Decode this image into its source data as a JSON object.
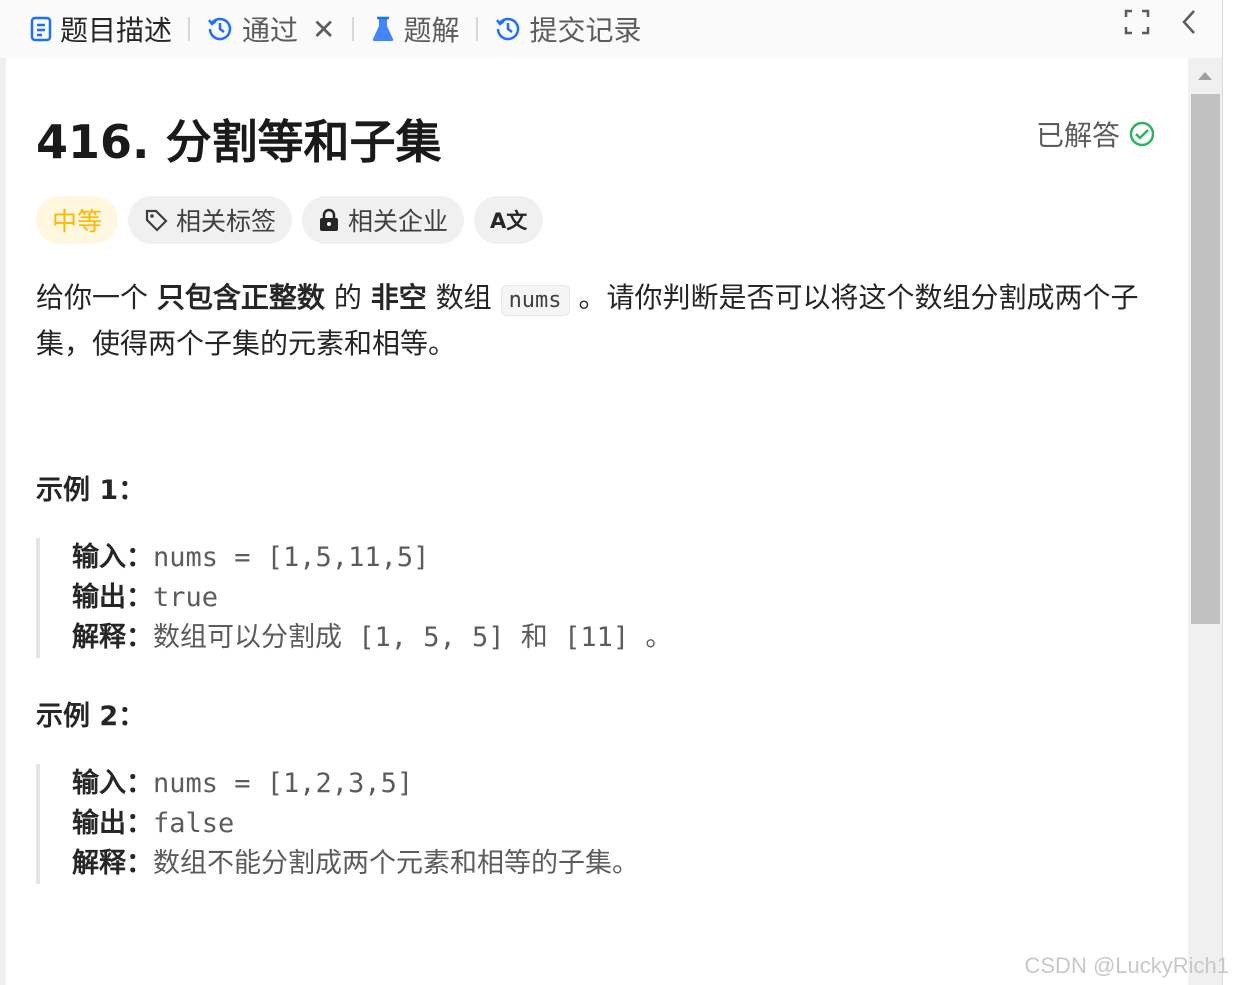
{
  "tabs": [
    {
      "label": "题目描述",
      "icon": "document-icon"
    },
    {
      "label": "通过",
      "icon": "history-icon"
    },
    {
      "label": "题解",
      "icon": "flask-icon"
    },
    {
      "label": "提交记录",
      "icon": "history-icon"
    }
  ],
  "tab_close": "✕",
  "problem": {
    "title": "416. 分割等和子集",
    "status": "已解答",
    "difficulty": "中等",
    "tag_topics": "相关标签",
    "tag_companies": "相关企业",
    "translate_glyph": "A文",
    "desc": {
      "p1": "给你一个 ",
      "b1": "只包含正整数",
      "p2": " 的 ",
      "b2": "非空",
      "p3": " 数组 ",
      "code": "nums",
      "p4": " 。请你判断是否可以将这个数组分割成两个子集，使得两个子集的元素和相等。"
    }
  },
  "examples": [
    {
      "title": "示例 1：",
      "input_label": "输入：",
      "input": "nums = [1,5,11,5]",
      "output_label": "输出：",
      "output": "true",
      "explain_label": "解释：",
      "explain": "数组可以分割成 [1, 5, 5] 和 [11] 。"
    },
    {
      "title": "示例 2：",
      "input_label": "输入：",
      "input": "nums = [1,2,3,5]",
      "output_label": "输出：",
      "output": "false",
      "explain_label": "解释：",
      "explain": "数组不能分割成两个元素和相等的子集。"
    }
  ],
  "watermark": "CSDN @LuckyRich1",
  "colors": {
    "accent_blue": "#1e6fff",
    "solved_green": "#2db55d",
    "medium_yellow": "#ffb800"
  }
}
